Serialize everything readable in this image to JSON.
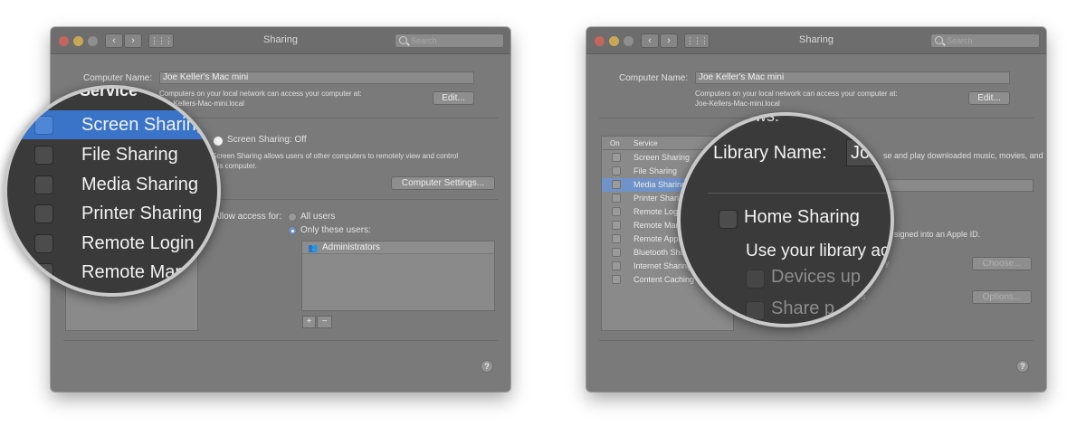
{
  "window": {
    "title": "Sharing",
    "search_placeholder": "Search",
    "nav_back": "‹",
    "nav_forward": "›",
    "grid": "⋮⋮⋮"
  },
  "computer_name": {
    "label": "Computer Name:",
    "value": "Joe Keller's Mac mini",
    "info_line1": "Computers on your local network can access your computer at:",
    "info_line2": "Joe-Kellers-Mac-mini.local",
    "edit_button": "Edit..."
  },
  "services": {
    "col_on": "On",
    "col_service": "Service",
    "items": [
      {
        "label": "Screen Sharing"
      },
      {
        "label": "File Sharing"
      },
      {
        "label": "Media Sharing"
      },
      {
        "label": "Printer Sharing"
      },
      {
        "label": "Remote Login"
      },
      {
        "label": "Remote Management"
      },
      {
        "label": "Remote Apple Events"
      },
      {
        "label": "Bluetooth Sharing"
      },
      {
        "label": "Internet Sharing"
      },
      {
        "label": "Content Caching"
      }
    ]
  },
  "left_panel": {
    "status": "Screen Sharing: Off",
    "desc_line1": "Screen Sharing allows users of other computers to remotely view and control",
    "desc_line2": "this computer.",
    "computer_settings_button": "Computer Settings...",
    "allow_access_label": "Allow access for:",
    "opt_all_users": "All users",
    "opt_only_these": "Only these users:",
    "users": [
      "Administrators"
    ],
    "add_button": "+",
    "remove_button": "−"
  },
  "left_magnifier": {
    "header": "Service",
    "rows": [
      "Screen Sharing",
      "File Sharing",
      "Media Sharing",
      "Printer Sharing",
      "Remote Login",
      "Remote Management"
    ]
  },
  "right_panel": {
    "truncated_top": "ows:",
    "library_desc": "se and play downloaded music, movies, and",
    "library_field_tail": "ry",
    "home_sharing_note": "signed into an Apple ID.",
    "devices_tail": "y",
    "choose_button": "Choose...",
    "share_tail": "s",
    "options_button": "Options..."
  },
  "right_magnifier": {
    "truncated_top": "ows:",
    "library_name_label": "Library Name:",
    "library_name_value": "Jo",
    "home_sharing": "Home Sharing",
    "use_library": "Use your library ac",
    "devices": "Devices up",
    "share_photos": "Share p"
  },
  "help": "?",
  "colors": {
    "selection": "#3a74c8",
    "window_bg": "#7a7a7a"
  }
}
